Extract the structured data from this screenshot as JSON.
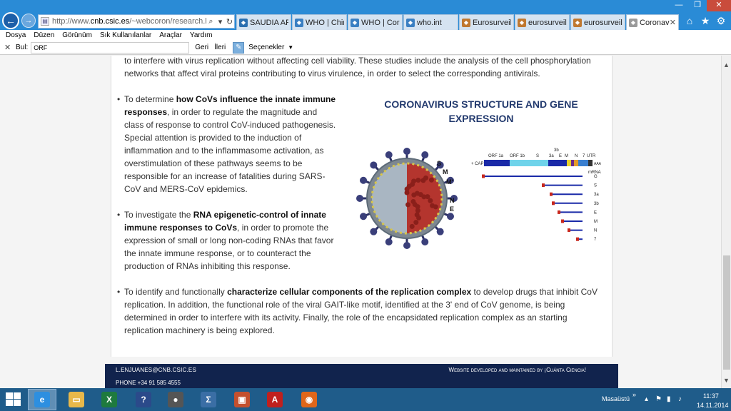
{
  "browser": {
    "url_prefix": "http://www.",
    "url_domain": "cnb.csic.es",
    "url_suffix": "/~webcoron/research.html",
    "tabs": [
      {
        "label": "SAUDIA AR...",
        "icon_color": "#2a6fb0",
        "active": false
      },
      {
        "label": "WHO | Chin...",
        "icon_color": "#3a7fc2",
        "active": false
      },
      {
        "label": "WHO | Coro...",
        "icon_color": "#3a7fc2",
        "active": false
      },
      {
        "label": "who.int",
        "icon_color": "#3a7fc2",
        "active": false
      },
      {
        "label": "Eurosurveill...",
        "icon_color": "#c07830",
        "active": false
      },
      {
        "label": "eurosurveill...",
        "icon_color": "#c07830",
        "active": false
      },
      {
        "label": "eurosurveill...",
        "icon_color": "#c07830",
        "active": false
      },
      {
        "label": "Coronavi...",
        "icon_color": "#9a9a9a",
        "active": true
      }
    ],
    "menu": [
      "Dosya",
      "Düzen",
      "Görünüm",
      "Sık Kullanılanlar",
      "Araçlar",
      "Yardım"
    ],
    "find": {
      "label": "Bul:",
      "value": "ORF",
      "prev": "Geri",
      "next": "İleri",
      "options": "Seçenekler"
    }
  },
  "page": {
    "intro": "to interfere with virus replication without affecting cell viability. These studies include the analysis of the cell phosphorylation networks that affect viral proteins contributing to virus virulence, in order to select the corresponding antivirals.",
    "bullet1": {
      "pre": "To determine ",
      "bold": "how CoVs influence the innate immune responses",
      "post": ", in order to regulate the magnitude and class of response to control CoV-induced pathogenesis. Special attention is provided to the induction of inflammation and to the inflammasome activation, as overstimulation of these pathways seems to be responsible for an increase of fatalities during SARS-CoV and MERS-CoV epidemics."
    },
    "bullet2": {
      "pre": "To investigate the ",
      "bold": "RNA epigenetic-control of innate immune responses to CoVs",
      "post": ", in order to promote the expression of small or long non-coding RNAs that favor the innate immune response, or to counteract the production of RNAs inhibiting this response."
    },
    "bullet3": {
      "pre": "To identify and functionally ",
      "bold": "characterize cellular components of the replication complex",
      "post": " to develop drugs that inhibit CoV replication. In addition, the functional role of the viral GAIT-like motif, identified at the 3' end of CoV genome, is being determined in order to interfere with its activity. Finally, the role of the encapsidated replication complex as an starting replication machinery is being explored."
    },
    "figure": {
      "title_line1": "CORONAVIRUS STRUCTURE AND GENE",
      "title_line2": "EXPRESSION",
      "virion_labels": [
        "S",
        "M",
        "M'",
        "N",
        "E"
      ],
      "genome_labels": [
        "ORF 1a",
        "ORF 1b",
        "S",
        "3b",
        "3a",
        "E",
        "M",
        "N",
        "7",
        "UTR"
      ],
      "cap_label": "+ CAP",
      "polya_label": "AAA",
      "mrna_label": "mRNA",
      "mrna_names": [
        "G",
        "S",
        "3a",
        "3b",
        "E",
        "M",
        "N",
        "7"
      ]
    },
    "footer": {
      "email": "L.ENJUANES@CNB.CSIC.ES",
      "phone": "PHONE +34 91 585 4555",
      "credit": "Website developed and maintained by ¡Cuánta Ciencia!"
    }
  },
  "taskbar": {
    "desktop_label": "Masaüstü",
    "time": "11:37",
    "date": "14.11.2014",
    "apps": [
      {
        "name": "internet-explorer",
        "glyph": "e",
        "color": "#2d8fe0"
      },
      {
        "name": "file-explorer",
        "glyph": "▭",
        "color": "#e8b84a"
      },
      {
        "name": "excel",
        "glyph": "X",
        "color": "#1e7a3e"
      },
      {
        "name": "help",
        "glyph": "?",
        "color": "#2b4a8a"
      },
      {
        "name": "globe-app",
        "glyph": "●",
        "color": "#555"
      },
      {
        "name": "math-app",
        "glyph": "Σ",
        "color": "#3a6ea5"
      },
      {
        "name": "presentation-app",
        "glyph": "▣",
        "color": "#c4502e"
      },
      {
        "name": "pdf-reader",
        "glyph": "A",
        "color": "#c0201e"
      },
      {
        "name": "firefox",
        "glyph": "◉",
        "color": "#e0661a"
      }
    ]
  }
}
